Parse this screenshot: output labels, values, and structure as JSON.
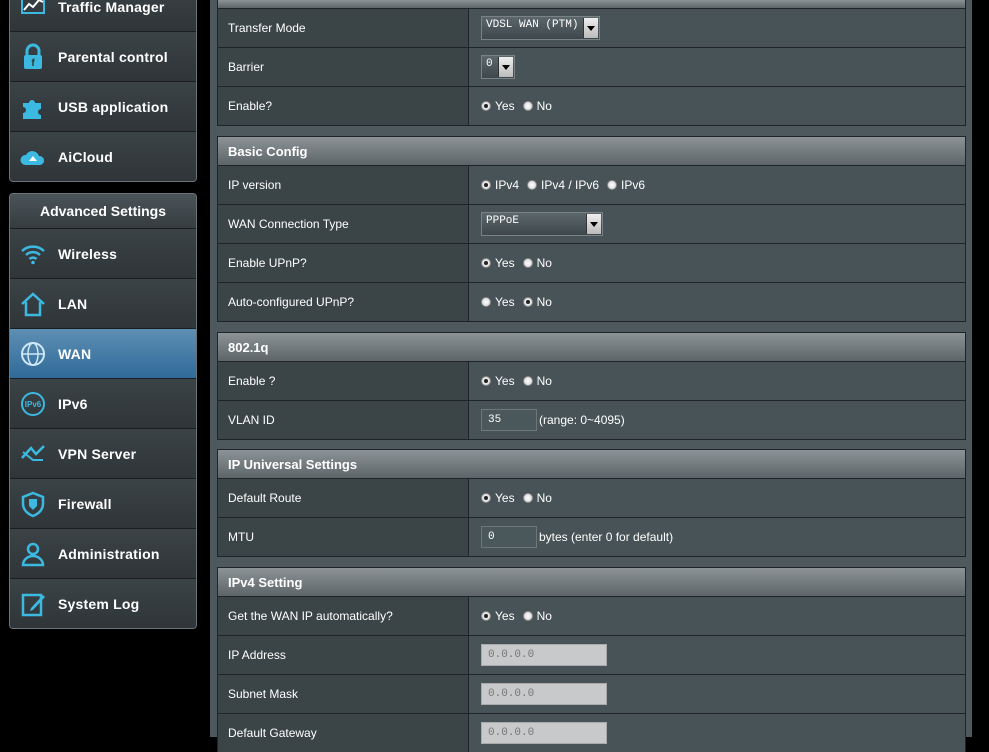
{
  "sidebar": {
    "top_items": [
      {
        "label": "Traffic Manager",
        "icon": "traffic-manager-icon"
      },
      {
        "label": "Parental control",
        "icon": "lock-icon"
      },
      {
        "label": "USB application",
        "icon": "puzzle-icon"
      },
      {
        "label": "AiCloud",
        "icon": "cloud-icon"
      }
    ],
    "advanced_header": "Advanced Settings",
    "advanced_items": [
      {
        "label": "Wireless",
        "icon": "wifi-icon"
      },
      {
        "label": "LAN",
        "icon": "home-icon"
      },
      {
        "label": "WAN",
        "icon": "globe-icon",
        "active": true
      },
      {
        "label": "IPv6",
        "icon": "ipv6-icon"
      },
      {
        "label": "VPN Server",
        "icon": "vpn-icon"
      },
      {
        "label": "Firewall",
        "icon": "shield-icon"
      },
      {
        "label": "Administration",
        "icon": "user-icon"
      },
      {
        "label": "System Log",
        "icon": "log-icon"
      }
    ]
  },
  "top_section": {
    "transfer_mode": {
      "label": "Transfer Mode",
      "value": "VDSL WAN (PTM)"
    },
    "barrier": {
      "label": "Barrier",
      "value": "0"
    },
    "enable": {
      "label": "Enable?",
      "yes": "Yes",
      "no": "No",
      "selected": "yes"
    }
  },
  "basic_config": {
    "title": "Basic Config",
    "ip_version": {
      "label": "IP version",
      "options": [
        "IPv4",
        "IPv4 / IPv6",
        "IPv6"
      ],
      "selected": "IPv4"
    },
    "wan_type": {
      "label": "WAN Connection Type",
      "value": "PPPoE"
    },
    "upnp": {
      "label": "Enable UPnP?",
      "yes": "Yes",
      "no": "No",
      "selected": "yes"
    },
    "auto_upnp": {
      "label": "Auto-configured UPnP?",
      "yes": "Yes",
      "no": "No",
      "selected": "no"
    }
  },
  "vlan": {
    "title": "802.1q",
    "enable": {
      "label": "Enable ?",
      "yes": "Yes",
      "no": "No",
      "selected": "yes"
    },
    "vlan_id": {
      "label": "VLAN ID",
      "value": "35",
      "hint": "(range: 0~4095)"
    }
  },
  "ip_universal": {
    "title": "IP Universal Settings",
    "default_route": {
      "label": "Default Route",
      "yes": "Yes",
      "no": "No",
      "selected": "yes"
    },
    "mtu": {
      "label": "MTU",
      "value": "0",
      "hint": "bytes (enter 0 for default)"
    }
  },
  "ipv4": {
    "title": "IPv4 Setting",
    "auto_ip": {
      "label": "Get the WAN IP automatically?",
      "yes": "Yes",
      "no": "No",
      "selected": "yes"
    },
    "ip_address": {
      "label": "IP Address",
      "value": "0.0.0.0"
    },
    "subnet": {
      "label": "Subnet Mask",
      "value": "0.0.0.0"
    },
    "gateway": {
      "label": "Default Gateway",
      "value": "0.0.0.0"
    }
  }
}
